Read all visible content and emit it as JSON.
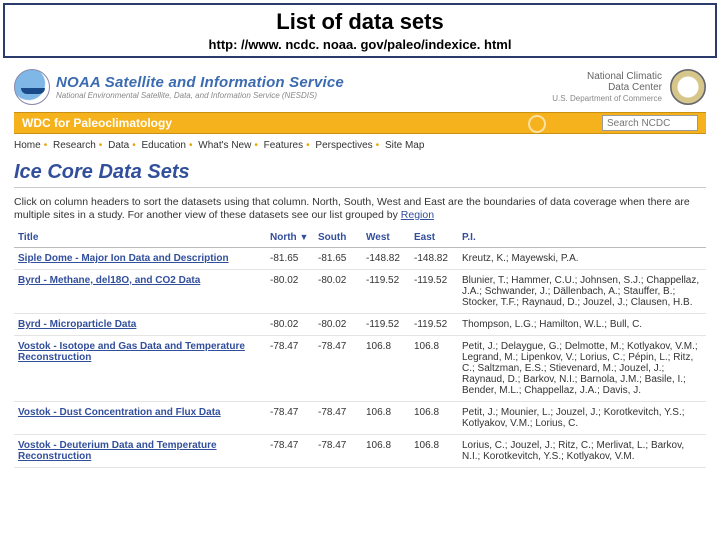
{
  "slide": {
    "title": "List of data sets",
    "url_text": "http: //www. ncdc. noaa. gov/paleo/indexice. html"
  },
  "header": {
    "satinfo_main": "NOAA Satellite and Information Service",
    "satinfo_sub": "National Environmental Satellite, Data, and Information Service (NESDIS)",
    "ncdc_line1": "National Climatic",
    "ncdc_line2": "Data Center",
    "ncdc_line3": "U.S. Department of Commerce"
  },
  "wdc": {
    "label": "WDC for Paleoclimatology",
    "search_placeholder": "Search NCDC"
  },
  "nav": {
    "items": [
      "Home",
      "Research",
      "Data",
      "Education",
      "What's New",
      "Features",
      "Perspectives",
      "Site Map"
    ]
  },
  "page_title": "Ice Core Data Sets",
  "intro_text_1": "Click on column headers to sort the datasets using that column. North, South, West and East are the boundaries of data coverage when there are multiple sites in a study. For another view of these datasets see our list grouped by ",
  "intro_link": "Region",
  "columns": {
    "title": "Title",
    "north": "North",
    "sort_indicator": "▼",
    "south": "South",
    "west": "West",
    "east": "East",
    "pi": "P.I."
  },
  "rows": [
    {
      "title": "Siple Dome - Major Ion Data and Description",
      "north": "-81.65",
      "south": "-81.65",
      "west": "-148.82",
      "east": "-148.82",
      "pi": "Kreutz, K.; Mayewski, P.A."
    },
    {
      "title": "Byrd - Methane, del18O, and CO2 Data",
      "north": "-80.02",
      "south": "-80.02",
      "west": "-119.52",
      "east": "-119.52",
      "pi": "Blunier, T.; Hammer, C.U.; Johnsen, S.J.; Chappellaz, J.A.; Schwander, J.; Dällenbach, A.; Stauffer, B.; Stocker, T.F.; Raynaud, D.; Jouzel, J.; Clausen, H.B."
    },
    {
      "title": "Byrd - Microparticle Data",
      "north": "-80.02",
      "south": "-80.02",
      "west": "-119.52",
      "east": "-119.52",
      "pi": "Thompson, L.G.; Hamilton, W.L.; Bull, C."
    },
    {
      "title": "Vostok - Isotope and Gas Data and Temperature Reconstruction",
      "north": "-78.47",
      "south": "-78.47",
      "west": "106.8",
      "east": "106.8",
      "pi": "Petit, J.; Delaygue, G.; Delmotte, M.; Kotlyakov, V.M.; Legrand, M.; Lipenkov, V.; Lorius, C.; Pépin, L.; Ritz, C.; Saltzman, E.S.; Stievenard, M.; Jouzel, J.; Raynaud, D.; Barkov, N.I.; Barnola, J.M.; Basile, I.; Bender, M.L.; Chappellaz, J.A.; Davis, J."
    },
    {
      "title": "Vostok - Dust Concentration and Flux Data",
      "north": "-78.47",
      "south": "-78.47",
      "west": "106.8",
      "east": "106.8",
      "pi": "Petit, J.; Mounier, L.; Jouzel, J.; Korotkevitch, Y.S.; Kotlyakov, V.M.; Lorius, C."
    },
    {
      "title": "Vostok - Deuterium Data and Temperature Reconstruction",
      "north": "-78.47",
      "south": "-78.47",
      "west": "106.8",
      "east": "106.8",
      "pi": "Lorius, C.; Jouzel, J.; Ritz, C.; Merlivat, L.; Barkov, N.I.; Korotkevitch, Y.S.; Kotlyakov, V.M."
    }
  ]
}
